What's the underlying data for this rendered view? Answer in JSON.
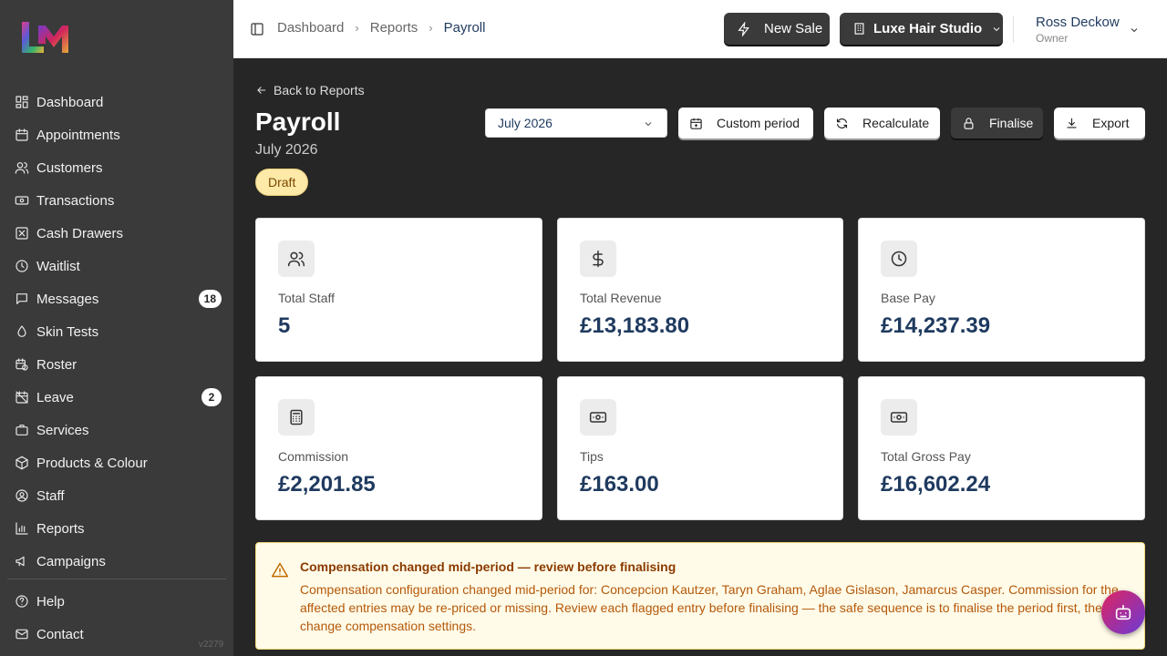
{
  "sidebar": {
    "items": [
      {
        "label": "Dashboard",
        "icon": "grid-icon"
      },
      {
        "label": "Appointments",
        "icon": "calendar-icon"
      },
      {
        "label": "Customers",
        "icon": "users-icon"
      },
      {
        "label": "Transactions",
        "icon": "banknote-icon"
      },
      {
        "label": "Cash Drawers",
        "icon": "square-x-icon"
      },
      {
        "label": "Waitlist",
        "icon": "clock-icon"
      },
      {
        "label": "Messages",
        "icon": "message-icon",
        "badge": "18"
      },
      {
        "label": "Skin Tests",
        "icon": "droplet-icon"
      },
      {
        "label": "Roster",
        "icon": "calendar-clock-icon"
      },
      {
        "label": "Leave",
        "icon": "calendar-off-icon",
        "badge": "2"
      },
      {
        "label": "Services",
        "icon": "briefcase-icon"
      },
      {
        "label": "Products & Colour",
        "icon": "package-icon"
      },
      {
        "label": "Staff",
        "icon": "user-circle-icon"
      },
      {
        "label": "Reports",
        "icon": "bar-chart-icon"
      },
      {
        "label": "Campaigns",
        "icon": "megaphone-icon"
      }
    ],
    "bottom": [
      {
        "label": "Help",
        "icon": "help-circle-icon"
      },
      {
        "label": "Contact",
        "icon": "mail-icon"
      }
    ],
    "version": "v2279"
  },
  "header": {
    "breadcrumbs": [
      "Dashboard",
      "Reports",
      "Payroll"
    ],
    "new_sale": "New Sale",
    "studio": "Luxe Hair Studio",
    "user_name": "Ross Deckow",
    "user_role": "Owner"
  },
  "page": {
    "back": "Back to Reports",
    "title": "Payroll",
    "subtitle": "July 2026",
    "status": "Draft",
    "period_value": "July 2026",
    "actions": {
      "custom_period": "Custom period",
      "recalculate": "Recalculate",
      "finalise": "Finalise",
      "export": "Export"
    }
  },
  "stats": [
    {
      "label": "Total Staff",
      "value": "5",
      "icon": "users-icon"
    },
    {
      "label": "Total Revenue",
      "value": "£13,183.80",
      "icon": "dollar-icon"
    },
    {
      "label": "Base Pay",
      "value": "£14,237.39",
      "icon": "clock-icon"
    },
    {
      "label": "Commission",
      "value": "£2,201.85",
      "icon": "calculator-icon"
    },
    {
      "label": "Tips",
      "value": "£163.00",
      "icon": "banknote-icon"
    },
    {
      "label": "Total Gross Pay",
      "value": "£16,602.24",
      "icon": "banknote-icon"
    }
  ],
  "alert": {
    "title": "Compensation changed mid-period — review before finalising",
    "body": "Compensation configuration changed mid-period for: Concepcion Kautzer, Taryn Graham, Aglae Gislason, Jamarcus Casper. Commission for the affected entries may be re-priced or missing. Review each flagged entry before finalising — the safe sequence is to finalise the period first, then change compensation settings."
  },
  "colors": {
    "sidebar_bg": "#3a3a3a",
    "main_bg": "#262626",
    "accent_navy": "#1f3a5f",
    "draft_badge": "#fde9a8",
    "warning_text": "#b5580a"
  }
}
